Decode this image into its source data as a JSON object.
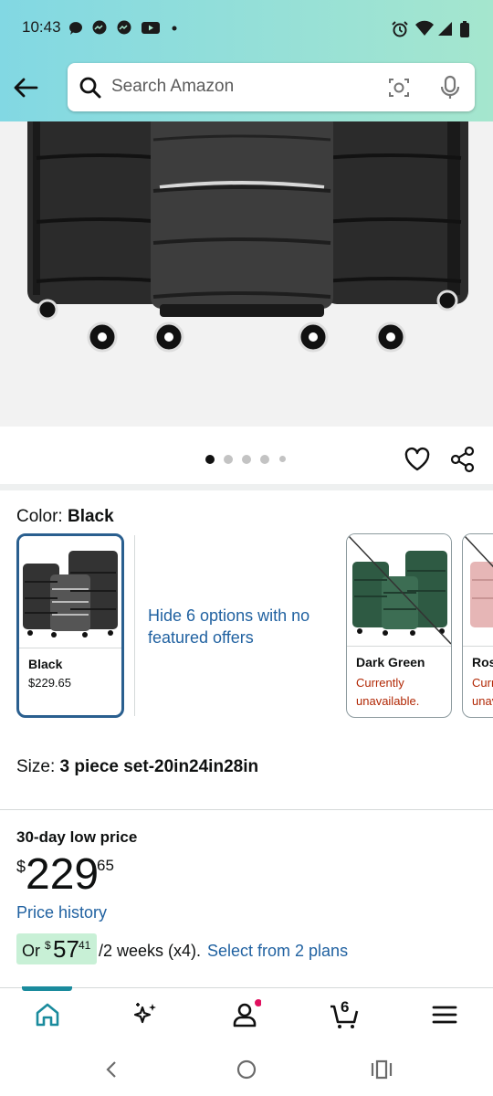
{
  "status_bar": {
    "time": "10:43"
  },
  "search": {
    "placeholder": "Search Amazon"
  },
  "carousel": {
    "dot_count": 5,
    "active_index": 0
  },
  "color": {
    "label": "Color:",
    "value": "Black",
    "options": [
      {
        "name": "Black",
        "price": "$229.65"
      },
      {
        "name": "Dark Green",
        "status": "Currently unavailable."
      },
      {
        "name": "Rose",
        "status": "Currently unavailable."
      }
    ],
    "hide_options_text": "Hide 6 options with no featured offers"
  },
  "size": {
    "label": "Size:",
    "value": "3 piece set-20in24in28in"
  },
  "pricing": {
    "low_price_label": "30-day low price",
    "currency_symbol": "$",
    "price_whole": "229",
    "price_fraction": "65",
    "price_history_link": "Price history",
    "plan_prefix": "Or",
    "plan_symbol": "$",
    "plan_whole": "57",
    "plan_fraction": "41",
    "plan_suffix": "/2 weeks (x4).",
    "plan_link": "Select from 2 plans"
  },
  "bottom_nav": {
    "items": [
      "home",
      "ai-assistant",
      "account",
      "cart",
      "menu"
    ],
    "cart_count": "6"
  },
  "colors": {
    "link": "#2162a1",
    "unavailable": "#b12704",
    "accent": "#1a8b9d",
    "chip": "#c8f0d6"
  }
}
